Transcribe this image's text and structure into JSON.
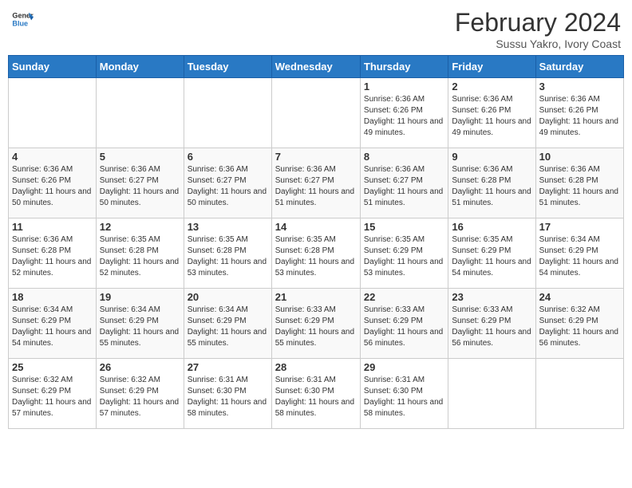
{
  "logo": {
    "line1": "General",
    "line2": "Blue"
  },
  "title": "February 2024",
  "subtitle": "Sussu Yakro, Ivory Coast",
  "weekdays": [
    "Sunday",
    "Monday",
    "Tuesday",
    "Wednesday",
    "Thursday",
    "Friday",
    "Saturday"
  ],
  "weeks": [
    [
      {
        "day": "",
        "info": ""
      },
      {
        "day": "",
        "info": ""
      },
      {
        "day": "",
        "info": ""
      },
      {
        "day": "",
        "info": ""
      },
      {
        "day": "1",
        "info": "Sunrise: 6:36 AM\nSunset: 6:26 PM\nDaylight: 11 hours and 49 minutes."
      },
      {
        "day": "2",
        "info": "Sunrise: 6:36 AM\nSunset: 6:26 PM\nDaylight: 11 hours and 49 minutes."
      },
      {
        "day": "3",
        "info": "Sunrise: 6:36 AM\nSunset: 6:26 PM\nDaylight: 11 hours and 49 minutes."
      }
    ],
    [
      {
        "day": "4",
        "info": "Sunrise: 6:36 AM\nSunset: 6:26 PM\nDaylight: 11 hours and 50 minutes."
      },
      {
        "day": "5",
        "info": "Sunrise: 6:36 AM\nSunset: 6:27 PM\nDaylight: 11 hours and 50 minutes."
      },
      {
        "day": "6",
        "info": "Sunrise: 6:36 AM\nSunset: 6:27 PM\nDaylight: 11 hours and 50 minutes."
      },
      {
        "day": "7",
        "info": "Sunrise: 6:36 AM\nSunset: 6:27 PM\nDaylight: 11 hours and 51 minutes."
      },
      {
        "day": "8",
        "info": "Sunrise: 6:36 AM\nSunset: 6:27 PM\nDaylight: 11 hours and 51 minutes."
      },
      {
        "day": "9",
        "info": "Sunrise: 6:36 AM\nSunset: 6:28 PM\nDaylight: 11 hours and 51 minutes."
      },
      {
        "day": "10",
        "info": "Sunrise: 6:36 AM\nSunset: 6:28 PM\nDaylight: 11 hours and 51 minutes."
      }
    ],
    [
      {
        "day": "11",
        "info": "Sunrise: 6:36 AM\nSunset: 6:28 PM\nDaylight: 11 hours and 52 minutes."
      },
      {
        "day": "12",
        "info": "Sunrise: 6:35 AM\nSunset: 6:28 PM\nDaylight: 11 hours and 52 minutes."
      },
      {
        "day": "13",
        "info": "Sunrise: 6:35 AM\nSunset: 6:28 PM\nDaylight: 11 hours and 53 minutes."
      },
      {
        "day": "14",
        "info": "Sunrise: 6:35 AM\nSunset: 6:28 PM\nDaylight: 11 hours and 53 minutes."
      },
      {
        "day": "15",
        "info": "Sunrise: 6:35 AM\nSunset: 6:29 PM\nDaylight: 11 hours and 53 minutes."
      },
      {
        "day": "16",
        "info": "Sunrise: 6:35 AM\nSunset: 6:29 PM\nDaylight: 11 hours and 54 minutes."
      },
      {
        "day": "17",
        "info": "Sunrise: 6:34 AM\nSunset: 6:29 PM\nDaylight: 11 hours and 54 minutes."
      }
    ],
    [
      {
        "day": "18",
        "info": "Sunrise: 6:34 AM\nSunset: 6:29 PM\nDaylight: 11 hours and 54 minutes."
      },
      {
        "day": "19",
        "info": "Sunrise: 6:34 AM\nSunset: 6:29 PM\nDaylight: 11 hours and 55 minutes."
      },
      {
        "day": "20",
        "info": "Sunrise: 6:34 AM\nSunset: 6:29 PM\nDaylight: 11 hours and 55 minutes."
      },
      {
        "day": "21",
        "info": "Sunrise: 6:33 AM\nSunset: 6:29 PM\nDaylight: 11 hours and 55 minutes."
      },
      {
        "day": "22",
        "info": "Sunrise: 6:33 AM\nSunset: 6:29 PM\nDaylight: 11 hours and 56 minutes."
      },
      {
        "day": "23",
        "info": "Sunrise: 6:33 AM\nSunset: 6:29 PM\nDaylight: 11 hours and 56 minutes."
      },
      {
        "day": "24",
        "info": "Sunrise: 6:32 AM\nSunset: 6:29 PM\nDaylight: 11 hours and 56 minutes."
      }
    ],
    [
      {
        "day": "25",
        "info": "Sunrise: 6:32 AM\nSunset: 6:29 PM\nDaylight: 11 hours and 57 minutes."
      },
      {
        "day": "26",
        "info": "Sunrise: 6:32 AM\nSunset: 6:29 PM\nDaylight: 11 hours and 57 minutes."
      },
      {
        "day": "27",
        "info": "Sunrise: 6:31 AM\nSunset: 6:30 PM\nDaylight: 11 hours and 58 minutes."
      },
      {
        "day": "28",
        "info": "Sunrise: 6:31 AM\nSunset: 6:30 PM\nDaylight: 11 hours and 58 minutes."
      },
      {
        "day": "29",
        "info": "Sunrise: 6:31 AM\nSunset: 6:30 PM\nDaylight: 11 hours and 58 minutes."
      },
      {
        "day": "",
        "info": ""
      },
      {
        "day": "",
        "info": ""
      }
    ]
  ]
}
